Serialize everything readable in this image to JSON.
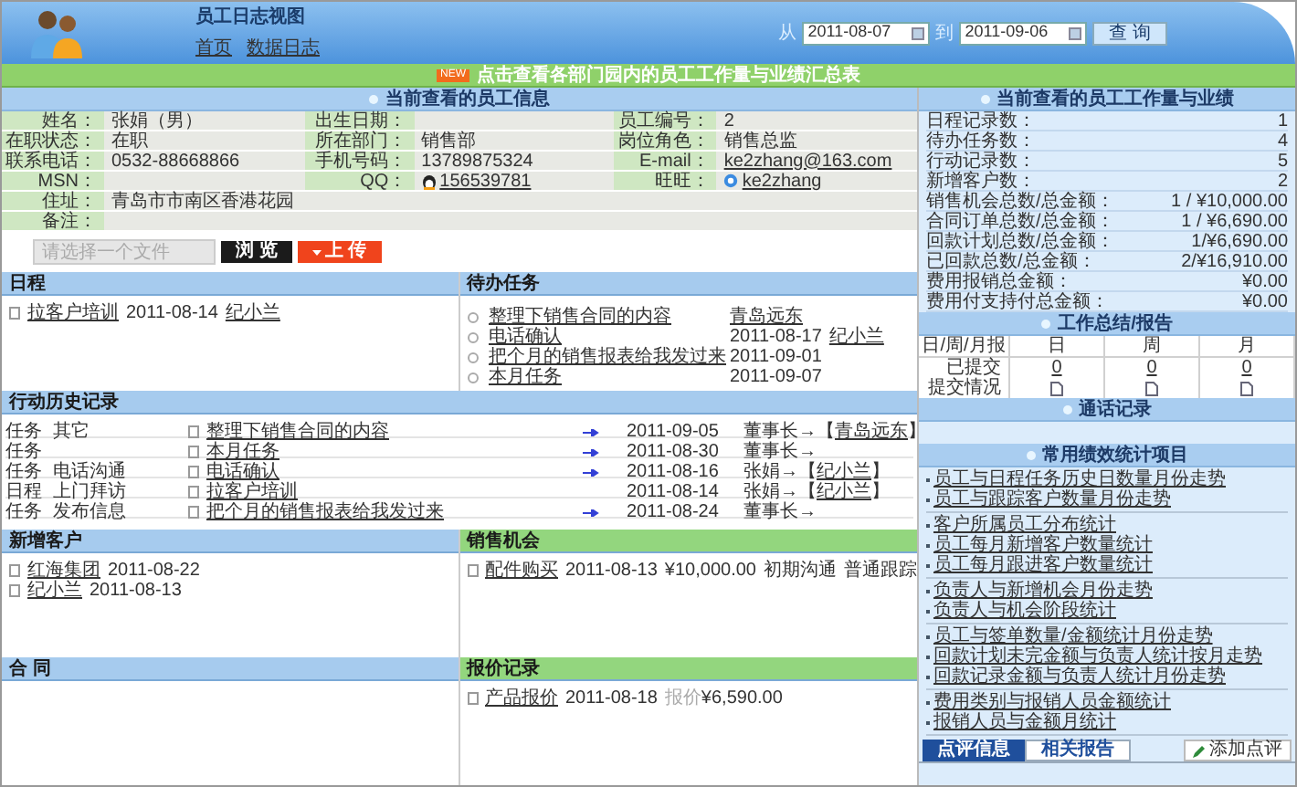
{
  "header": {
    "title": "员工日志视图",
    "links": [
      "首页",
      "数据日志"
    ],
    "from_label": "从",
    "date_from": "2011-08-07",
    "to_label": "到",
    "date_to": "2011-09-06",
    "query_button": "查 询"
  },
  "notice": {
    "badge": "NEW",
    "text": "点击查看各部门园内的员工工作量与业绩汇总表"
  },
  "employee_info": {
    "title": "当前查看的员工信息",
    "rows": [
      [
        {
          "label": "姓名：",
          "value": "张娟（男）",
          "kind": "text"
        },
        {
          "label": "出生日期："
        },
        {
          "label": "员工编号：",
          "value": "2",
          "kind": "text"
        }
      ],
      [
        {
          "label": "在职状态：",
          "value": "在职",
          "kind": "text"
        },
        {
          "label": "所在部门：",
          "value": "销售部",
          "kind": "text"
        },
        {
          "label": "岗位角色：",
          "value": "销售总监",
          "kind": "text"
        }
      ],
      [
        {
          "label": "联系电话：",
          "value": "0532-88668866",
          "kind": "text"
        },
        {
          "label": "手机号码：",
          "value": "13789875324",
          "kind": "text"
        },
        {
          "label": "E-mail：",
          "value": "ke2zhang@163.com",
          "kind": "link"
        }
      ],
      [
        {
          "label": "MSN："
        },
        {
          "label": "QQ：",
          "value": "156539781",
          "kind": "qq"
        },
        {
          "label": "旺旺：",
          "value": "ke2zhang",
          "kind": "im"
        }
      ],
      [
        {
          "label": "住址：",
          "value": "青岛市市南区香港花园",
          "kind": "text"
        }
      ],
      [
        {
          "label": "备注："
        }
      ]
    ]
  },
  "upload": {
    "placeholder": "请选择一个文件",
    "browse_button": "浏 览",
    "upload_button": "上 传"
  },
  "schedule": {
    "title": "日程",
    "color": "#a6cbee",
    "items": [
      {
        "subject": "拉客户培训",
        "date": "2011-08-14",
        "person": "纪小兰"
      }
    ]
  },
  "todo": {
    "title": "待办任务",
    "color": "#a6cbee",
    "items": [
      {
        "subject": "整理下销售合同的内容",
        "related": "青岛远东"
      },
      {
        "subject": "电话确认",
        "date": "2011-08-17",
        "related": "纪小兰"
      },
      {
        "subject": "把个月的销售报表给我发过来",
        "date": "2011-09-01"
      },
      {
        "subject": "本月任务",
        "date": "2011-09-07"
      }
    ]
  },
  "action_history": {
    "title": "行动历史记录",
    "color": "#a6cbee",
    "rows": [
      {
        "type": "任务",
        "category": "其它",
        "subject": "整理下销售合同的内容",
        "arrow": true,
        "date": "2011-09-05",
        "route": "董事长→【",
        "target": "青岛远东",
        "route_end": "】"
      },
      {
        "type": "任务",
        "subject": "本月任务",
        "arrow": true,
        "date": "2011-08-30",
        "route": "董事长→"
      },
      {
        "type": "任务",
        "category": "电话沟通",
        "subject": "电话确认",
        "arrow": true,
        "date": "2011-08-16",
        "route": "张娟→【",
        "target": "纪小兰",
        "route_end": "】"
      },
      {
        "type": "日程",
        "category": "上门拜访",
        "subject": "拉客户培训",
        "arrow": false,
        "date": "2011-08-14",
        "route": "张娟→【",
        "target": "纪小兰",
        "route_end": "】"
      },
      {
        "type": "任务",
        "category": "发布信息",
        "subject": "把个月的销售报表给我发过来",
        "arrow": true,
        "date": "2011-08-24",
        "route": "董事长→"
      }
    ]
  },
  "new_customers": {
    "title": "新增客户",
    "color": "#a6cbee",
    "items": [
      {
        "name": "红海集团",
        "date": "2011-08-22"
      },
      {
        "name": "纪小兰",
        "date": "2011-08-13"
      }
    ]
  },
  "opportunities": {
    "title": "销售机会",
    "color": "#93d67e",
    "items": [
      {
        "subject": "配件购买",
        "date": "2011-08-13",
        "amount": "¥10,000.00",
        "stage": "初期沟通",
        "status": "普通跟踪"
      }
    ]
  },
  "contracts": {
    "title": "合 同",
    "color": "#a6cbee"
  },
  "quotes": {
    "title": "报价记录",
    "color": "#93d67e",
    "items": [
      {
        "subject": "产品报价",
        "date": "2011-08-18",
        "amount_label": "报价",
        "amount": "¥6,590.00"
      }
    ]
  },
  "stats": {
    "title": "当前查看的员工工作量与业绩",
    "rows": [
      {
        "label": "日程记录数：",
        "value": "1"
      },
      {
        "label": "待办任务数：",
        "value": "4"
      },
      {
        "label": "行动记录数：",
        "value": "5"
      },
      {
        "label": "新增客户数：",
        "value": "2"
      },
      {
        "label": "销售机会总数/总金额：",
        "value": "1 / ¥10,000.00"
      },
      {
        "label": "合同订单总数/总金额：",
        "value": "1 / ¥6,690.00"
      },
      {
        "label": "回款计划总数/总金额：",
        "value": "1/¥6,690.00"
      },
      {
        "label": "已回款总数/总金额：",
        "value": "2/¥16,910.00"
      },
      {
        "label": "费用报销总金额：",
        "value": "¥0.00"
      },
      {
        "label": "费用付支持付总金额：",
        "value": "¥0.00"
      }
    ]
  },
  "reports": {
    "title": "工作总结/报告",
    "columns": [
      "日/周/月报",
      "日",
      "周",
      "月"
    ],
    "rows": [
      {
        "label": "已提交",
        "kind": "counts",
        "cells": [
          "0",
          "0",
          "0"
        ]
      },
      {
        "label": "提交情况",
        "kind": "icons"
      }
    ]
  },
  "calls": {
    "title": "通话记录"
  },
  "stat_links": {
    "title": "常用绩效统计项目",
    "groups": [
      [
        "员工与日程任务历史日数量月份走势",
        "员工与跟踪客户数量月份走势"
      ],
      [
        "客户所属员工分布统计",
        "员工每月新增客户数量统计",
        "员工每月跟进客户数量统计"
      ],
      [
        "负责人与新增机会月份走势",
        "负责人与机会阶段统计"
      ],
      [
        "员工与签单数量/金额统计月份走势",
        "回款计划未完金额与负责人统计按月走势",
        "回款记录金额与负责人统计月份走势"
      ],
      [
        "费用类别与报销人员金额统计",
        "报销人员与金额月统计"
      ]
    ]
  },
  "comment_tabs": [
    {
      "label": "点评信息",
      "selected": true
    },
    {
      "label": "相关报告",
      "selected": false
    }
  ],
  "add_comment_button": "添加点评"
}
